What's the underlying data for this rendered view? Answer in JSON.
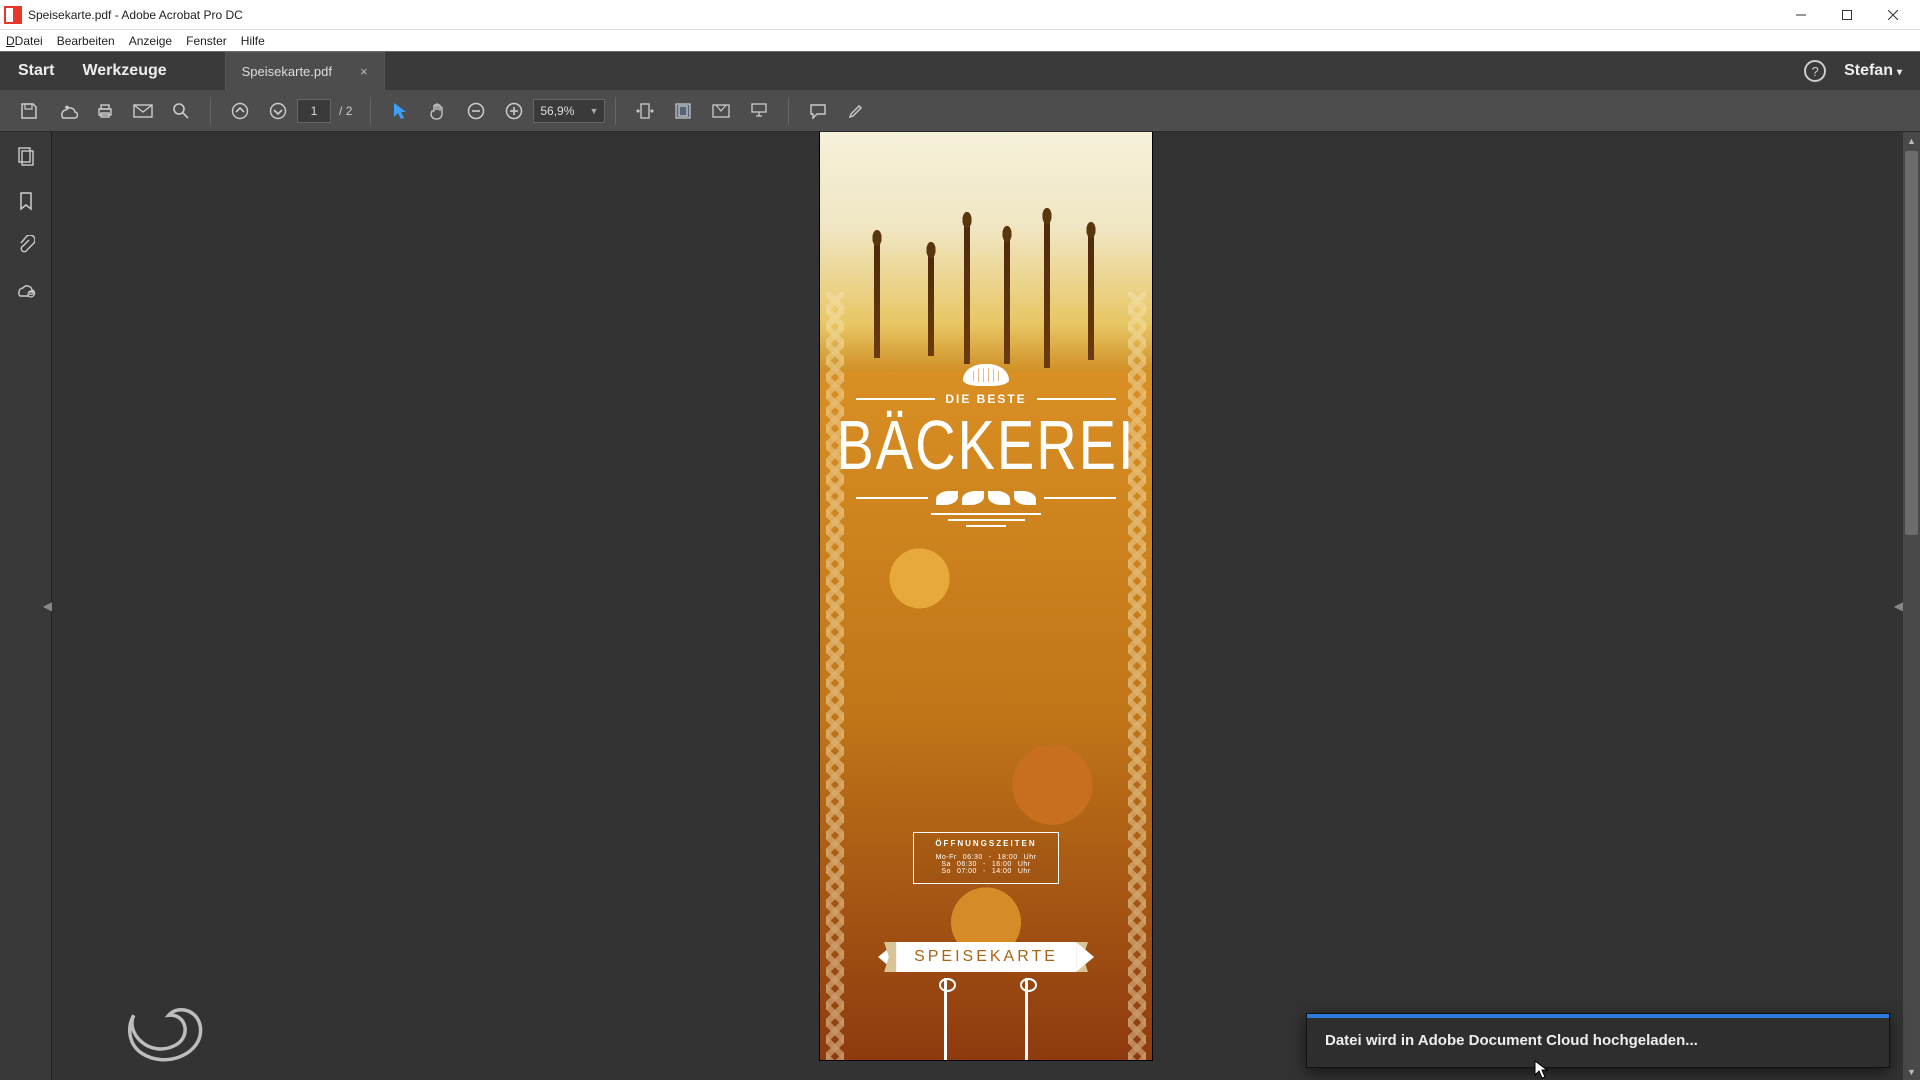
{
  "titlebar": {
    "title": "Speisekarte.pdf - Adobe Acrobat Pro DC"
  },
  "menubar": {
    "file": "Datei",
    "edit": "Bearbeiten",
    "view": "Anzeige",
    "window": "Fenster",
    "help": "Hilfe"
  },
  "tabs": {
    "start": "Start",
    "tools": "Werkzeuge",
    "doc": "Speisekarte.pdf",
    "close": "×",
    "user": "Stefan",
    "help_glyph": "?"
  },
  "toolbar": {
    "page_current": "1",
    "page_sep": "/",
    "page_total": "2",
    "zoom": "56,9%"
  },
  "pdf": {
    "tagline": "DIE BESTE",
    "title": "BÄCKEREI",
    "hours_title": "ÖFFNUNGSZEITEN",
    "hours": [
      {
        "d": "Mo-Fr",
        "o": "06:30",
        "dash": "-",
        "c": "18:00",
        "u": "Uhr"
      },
      {
        "d": "Sa",
        "o": "06:30",
        "dash": "-",
        "c": "16:00",
        "u": "Uhr"
      },
      {
        "d": "So",
        "o": "07:00",
        "dash": "-",
        "c": "14:00",
        "u": "Uhr"
      }
    ],
    "ribbon": "SPEISEKARTE"
  },
  "toast": {
    "message": "Datei wird in Adobe Document Cloud hochgeladen..."
  }
}
